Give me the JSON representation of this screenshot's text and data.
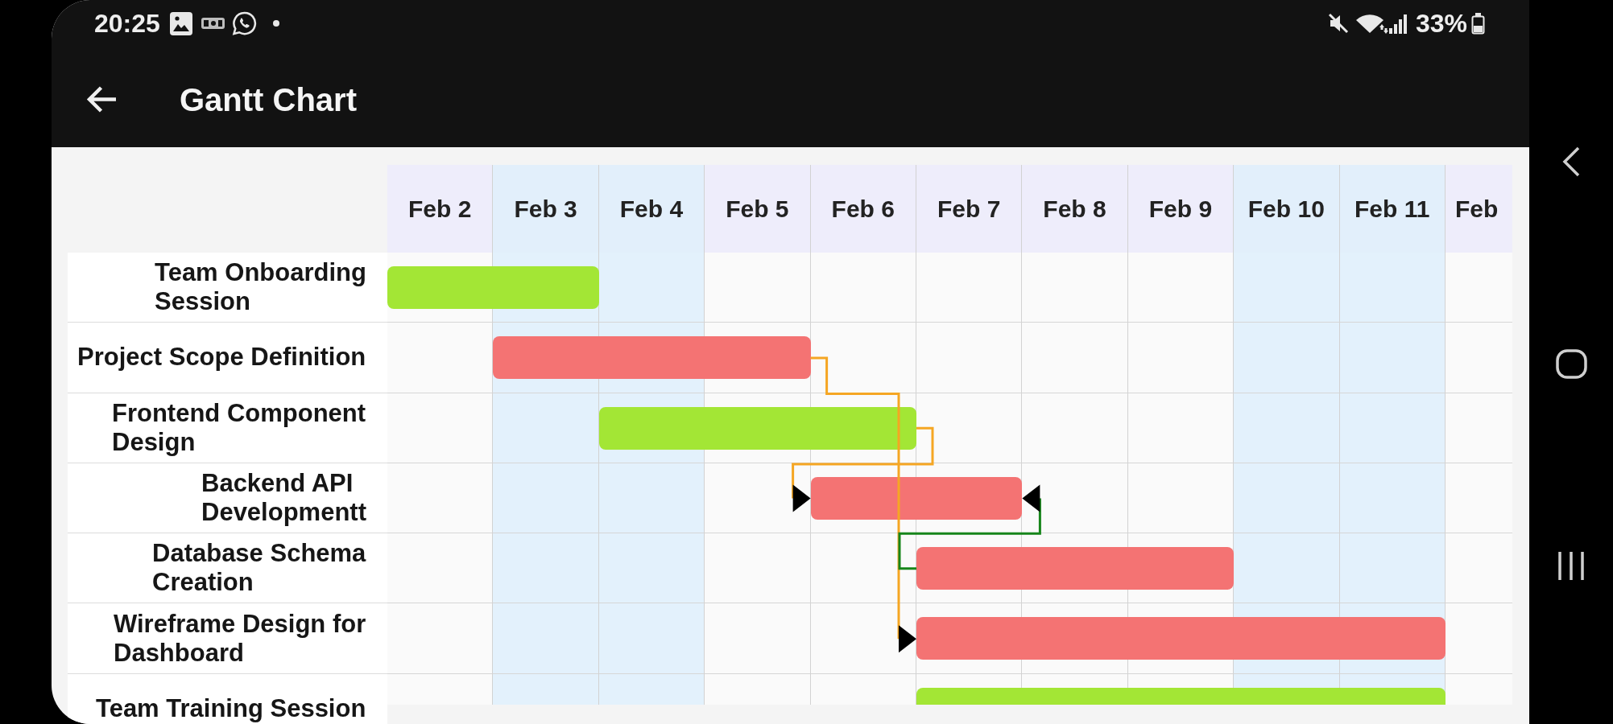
{
  "status_bar": {
    "time": "20:25",
    "battery": "33%"
  },
  "app_bar": {
    "title": "Gantt Chart"
  },
  "gantt": {
    "dates": [
      {
        "label": "Feb 2",
        "weekend": false
      },
      {
        "label": "Feb 3",
        "weekend": true
      },
      {
        "label": "Feb 4",
        "weekend": true
      },
      {
        "label": "Feb 5",
        "weekend": false
      },
      {
        "label": "Feb 6",
        "weekend": false
      },
      {
        "label": "Feb 7",
        "weekend": false
      },
      {
        "label": "Feb 8",
        "weekend": false
      },
      {
        "label": "Feb 9",
        "weekend": false
      },
      {
        "label": "Feb 10",
        "weekend": true
      },
      {
        "label": "Feb 11",
        "weekend": true
      },
      {
        "label": "Feb",
        "weekend": false
      }
    ],
    "tasks": [
      {
        "name": "Team Onboarding Session",
        "color": "#a3e635",
        "days": [
          true,
          true,
          false,
          false,
          false,
          false,
          false,
          false,
          false,
          false,
          false
        ]
      },
      {
        "name": "Project Scope Definition",
        "color": "#f47373",
        "days": [
          false,
          true,
          true,
          true,
          false,
          false,
          false,
          false,
          false,
          false,
          false
        ]
      },
      {
        "name": "Frontend Component Design",
        "color": "#a3e635",
        "days": [
          false,
          false,
          true,
          true,
          true,
          false,
          false,
          false,
          false,
          false,
          false
        ]
      },
      {
        "name": "Backend API Developmentt",
        "color": "#f47373",
        "days": [
          false,
          false,
          false,
          false,
          true,
          true,
          false,
          false,
          false,
          false,
          false
        ]
      },
      {
        "name": "Database Schema Creation",
        "color": "#f47373",
        "days": [
          false,
          false,
          false,
          false,
          false,
          true,
          true,
          true,
          false,
          false,
          false
        ]
      },
      {
        "name": "Wireframe Design for Dashboard",
        "color": "#f47373",
        "days": [
          false,
          false,
          false,
          false,
          false,
          true,
          true,
          true,
          true,
          true,
          false
        ]
      },
      {
        "name": "Team Training Session",
        "color": "#a3e635",
        "days": [
          false,
          false,
          false,
          false,
          false,
          true,
          true,
          true,
          true,
          true,
          false
        ]
      }
    ],
    "dependencies": [
      {
        "kind": "finish-to-start",
        "color": "#f5a623"
      },
      {
        "kind": "finish-to-start",
        "color": "#f5a623"
      },
      {
        "kind": "start-to-finish",
        "color": "#16851a"
      }
    ]
  }
}
